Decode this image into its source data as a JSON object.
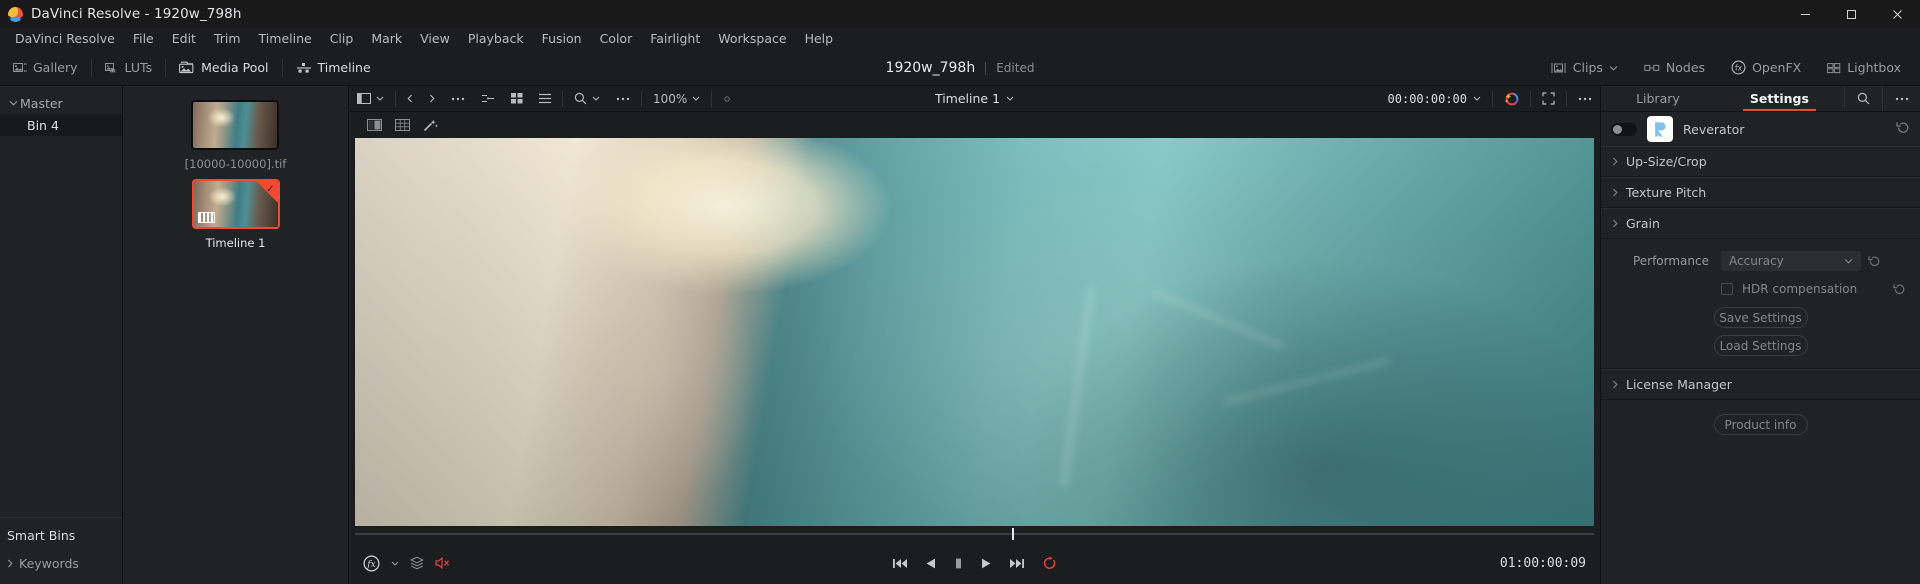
{
  "window": {
    "title": "DaVinci Resolve - 1920w_798h",
    "logo_icon": "resolve-logo-icon",
    "controls": [
      {
        "name": "minimize",
        "glyph": "─"
      },
      {
        "name": "maximize",
        "glyph": "❐"
      },
      {
        "name": "close",
        "glyph": "✕"
      }
    ]
  },
  "menubar": {
    "items": [
      "DaVinci Resolve",
      "File",
      "Edit",
      "Trim",
      "Timeline",
      "Clip",
      "Mark",
      "View",
      "Playback",
      "Fusion",
      "Color",
      "Fairlight",
      "Workspace",
      "Help"
    ]
  },
  "toolbar": {
    "left": [
      {
        "label": "Gallery",
        "icon": "gallery-icon",
        "active": false
      },
      {
        "label": "LUTs",
        "icon": "luts-icon",
        "active": false
      },
      {
        "label": "Media Pool",
        "icon": "media-pool-icon",
        "active": true
      },
      {
        "label": "Timeline",
        "icon": "timeline-icon",
        "active": true
      }
    ],
    "center": {
      "project_name": "1920w_798h",
      "state": "Edited"
    },
    "right": [
      {
        "label": "Clips",
        "icon": "clips-icon",
        "caret": true
      },
      {
        "label": "Nodes",
        "icon": "nodes-icon",
        "caret": false
      },
      {
        "label": "OpenFX",
        "icon": "openfx-icon",
        "caret": false
      },
      {
        "label": "Lightbox",
        "icon": "lightbox-icon",
        "caret": false
      }
    ]
  },
  "bins": {
    "master": {
      "label": "Master",
      "icon": "chevron-down-icon"
    },
    "children": [
      {
        "label": "Bin 4",
        "selected": true
      }
    ],
    "smart_bins": {
      "label": "Smart Bins",
      "items": [
        {
          "label": "Keywords",
          "icon": "chevron-right-icon"
        }
      ]
    }
  },
  "media_pool": {
    "items": [
      {
        "label": "[10000-10000].tif",
        "selected": false,
        "type": "still"
      },
      {
        "label": "Timeline 1",
        "selected": true,
        "type": "timeline"
      }
    ]
  },
  "viewer": {
    "top_bar": {
      "panel_icon": "panel-layout-icon",
      "caret_icon": "chevron-down-icon",
      "nav_prev_icon": "chevron-left-icon",
      "nav_next_icon": "chevron-right-icon",
      "overflow_icon": "ellipsis-icon",
      "node_icon": "node-graph-icon",
      "grid_icon": "grid-view-icon",
      "list_icon": "list-view-icon",
      "search_icon": "search-icon",
      "search_caret_icon": "chevron-down-icon",
      "zoom_level": "100%",
      "zoom_caret_icon": "chevron-down-icon",
      "clip_name": "Timeline 1",
      "clip_caret_icon": "chevron-down-icon",
      "timecode": "00:00:00:00",
      "timecode_caret_icon": "chevron-down-icon",
      "color_wheel_icon": "magic-color-icon",
      "fullscreen_icon": "expand-icon",
      "options_icon": "ellipsis-icon"
    },
    "tools": [
      {
        "icon": "split-screen-icon"
      },
      {
        "icon": "grid-overlay-icon"
      },
      {
        "icon": "magic-wand-icon"
      }
    ],
    "scrubber": {
      "position_percent": 53
    },
    "transport": {
      "fx_icon": "fx-icon",
      "fx_caret_icon": "chevron-down-icon",
      "layers_icon": "layers-icon",
      "mute_icon": "speaker-mute-icon",
      "buttons": [
        {
          "name": "skip-to-start",
          "icon": "skip-back-icon"
        },
        {
          "name": "play-reverse",
          "icon": "play-reverse-icon"
        },
        {
          "name": "stop",
          "icon": "stop-icon"
        },
        {
          "name": "play-forward",
          "icon": "play-forward-icon"
        },
        {
          "name": "skip-to-end",
          "icon": "skip-forward-icon"
        },
        {
          "name": "loop",
          "icon": "loop-icon"
        }
      ],
      "duration_timecode": "01:00:00:09"
    }
  },
  "inspector": {
    "tabs": [
      {
        "label": "Library",
        "active": false
      },
      {
        "label": "Settings",
        "active": true
      }
    ],
    "tab_icons": [
      {
        "name": "search-icon"
      },
      {
        "name": "ellipsis-icon"
      }
    ],
    "effect": {
      "enabled": false,
      "logo_letter": "R",
      "name": "Reverator",
      "reset_icon": "reset-icon"
    },
    "sections": [
      {
        "label": "Up-Size/Crop",
        "expanded": false,
        "caret_icon": "chevron-right-icon"
      },
      {
        "label": "Texture Pitch",
        "expanded": false,
        "caret_icon": "chevron-right-icon"
      },
      {
        "label": "Grain",
        "expanded": true,
        "caret_icon": "chevron-right-icon"
      }
    ],
    "grain_params": {
      "performance": {
        "label": "Performance",
        "value": "Accuracy",
        "caret_icon": "chevron-down-icon",
        "reset_icon": "reset-icon"
      },
      "hdr": {
        "label": "HDR compensation",
        "checked": false,
        "reset_icon": "reset-icon"
      },
      "save_settings": "Save Settings",
      "load_settings": "Load Settings"
    },
    "license_section": {
      "label": "License Manager",
      "caret_icon": "chevron-right-icon"
    },
    "product_info": "Product info"
  },
  "colors": {
    "accent": "#ef4b33",
    "panel_bg": "#202225",
    "app_bg": "#1b1d1f",
    "text": "#c8c9cb",
    "logo_blue": "#7fc3e8"
  }
}
